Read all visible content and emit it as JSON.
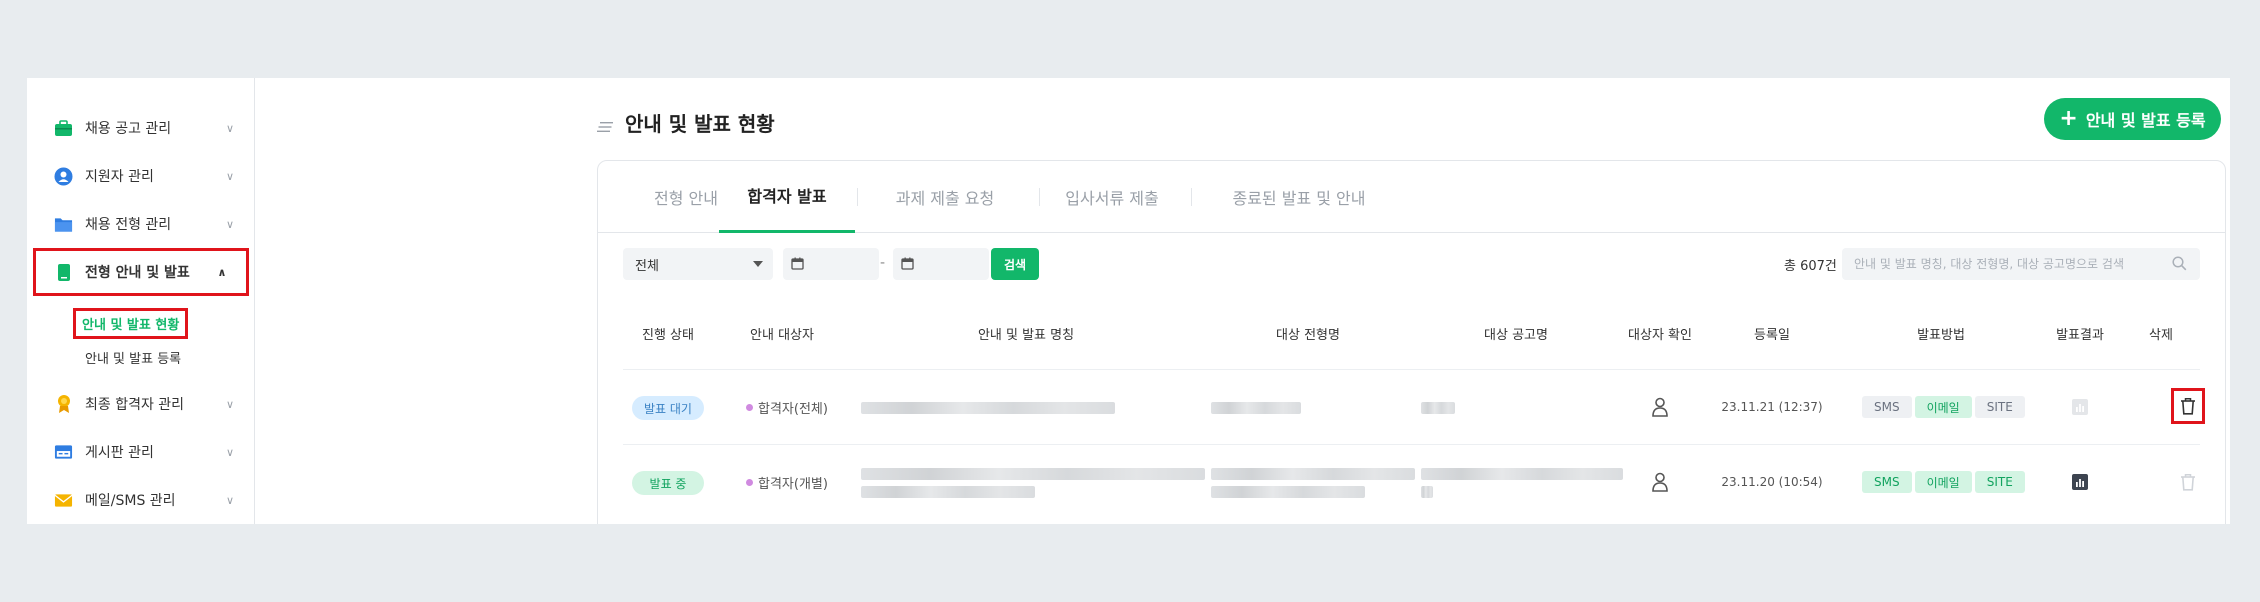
{
  "sidebar": {
    "items": [
      {
        "label": "채용 공고 관리",
        "icon": "briefcase-icon"
      },
      {
        "label": "지원자 관리",
        "icon": "user-circle-icon"
      },
      {
        "label": "채용 전형 관리",
        "icon": "folder-icon"
      },
      {
        "label": "전형 안내 및 발표",
        "icon": "phone-icon"
      },
      {
        "label": "최종 합격자 관리",
        "icon": "medal-icon"
      },
      {
        "label": "게시판 관리",
        "icon": "board-icon"
      },
      {
        "label": "메일/SMS 관리",
        "icon": "mail-icon"
      }
    ],
    "sub_items": [
      {
        "label": "안내 및 발표 현황"
      },
      {
        "label": "안내 및 발표 등록"
      }
    ]
  },
  "header": {
    "title": "안내 및 발표 현황",
    "register_button": "안내 및 발표 등록"
  },
  "tabs": [
    {
      "label": "전형 안내"
    },
    {
      "label": "합격자 발표"
    },
    {
      "label": "과제 제출 요청"
    },
    {
      "label": "입사서류 제출"
    },
    {
      "label": "종료된 발표 및 안내"
    }
  ],
  "filters": {
    "select_value": "전체",
    "date_separator": "-",
    "search_button": "검색",
    "total_count": "총 607건",
    "search_placeholder": "안내 및 발표 명칭, 대상 전형명, 대상 공고명으로 검색"
  },
  "table": {
    "columns": [
      "진행 상태",
      "안내 대상자",
      "안내 및 발표 명칭",
      "대상 전형명",
      "대상 공고명",
      "대상자 확인",
      "등록일",
      "발표방법",
      "발표결과",
      "삭제"
    ],
    "rows": [
      {
        "status": "발표 대기",
        "target": "합격자(전체)",
        "date": "23.11.21 (12:37)",
        "methods": [
          "SMS",
          "이메일",
          "SITE"
        ],
        "methods_active": [
          false,
          true,
          false
        ]
      },
      {
        "status": "발표 중",
        "target": "합격자(개별)",
        "date": "23.11.20 (10:54)",
        "methods": [
          "SMS",
          "이메일",
          "SITE"
        ],
        "methods_active": [
          true,
          true,
          true
        ]
      }
    ]
  },
  "colors": {
    "accent": "#12b76a",
    "highlight": "#e0141b",
    "status_waiting_bg": "#d6ecff",
    "status_waiting_fg": "#3b82c4",
    "status_active_bg": "#d3f4e3",
    "status_active_fg": "#12a35f"
  }
}
